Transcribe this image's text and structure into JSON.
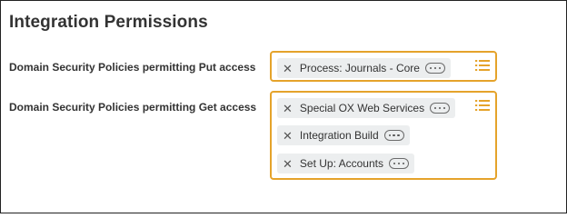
{
  "section_title": "Integration Permissions",
  "put_field": {
    "label": "Domain Security Policies permitting Put access",
    "items": [
      {
        "label": "Process: Journals - Core"
      }
    ]
  },
  "get_field": {
    "label": "Domain Security Policies permitting Get access",
    "items": [
      {
        "label": "Special OX Web Services"
      },
      {
        "label": "Integration Build"
      },
      {
        "label": "Set Up: Accounts"
      }
    ]
  },
  "icons": {
    "remove": "close-icon",
    "related_actions": "related-actions-icon",
    "prompt": "list-prompt-icon"
  },
  "colors": {
    "field_border": "#e5a32b",
    "pill_background": "#eceeef",
    "text": "#333333"
  }
}
